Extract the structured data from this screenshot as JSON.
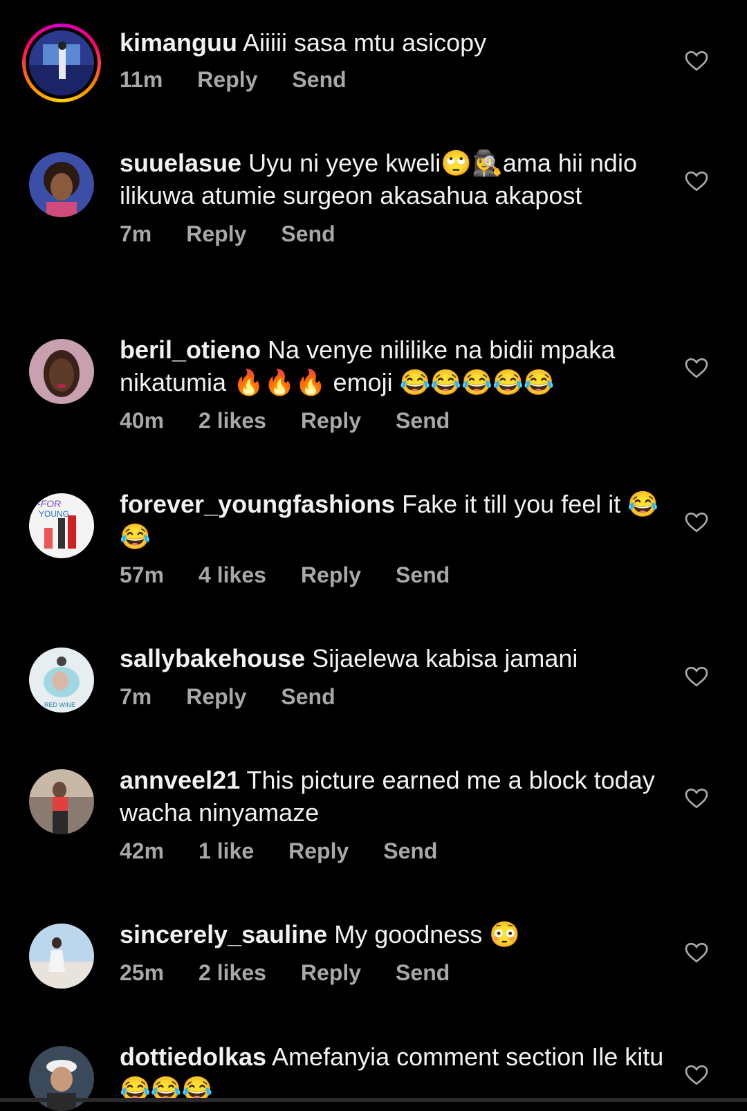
{
  "comments": [
    {
      "username": "kimanguu",
      "text": "Aiiiii sasa mtu asicopy",
      "time": "11m",
      "likes": "",
      "reply": "Reply",
      "send": "Send"
    },
    {
      "username": "suuelasue",
      "text": "Uyu ni yeye kweli🙄🕵️‍♀️ama hii ndio ilikuwa atumie surgeon akasahua akapost",
      "time": "7m",
      "likes": "",
      "reply": "Reply",
      "send": "Send"
    },
    {
      "username": "beril_otieno",
      "text": "Na venye nililike na bidii mpaka nikatumia 🔥🔥🔥 emoji 😂😂😂😂😂",
      "time": "40m",
      "likes": "2 likes",
      "reply": "Reply",
      "send": "Send"
    },
    {
      "username": "forever_youngfashions",
      "text": "Fake it till you feel it 😂😂",
      "time": "57m",
      "likes": "4 likes",
      "reply": "Reply",
      "send": "Send"
    },
    {
      "username": "sallybakehouse",
      "text": "Sijaelewa kabisa jamani",
      "time": "7m",
      "likes": "",
      "reply": "Reply",
      "send": "Send"
    },
    {
      "username": "annveel21",
      "text": "This picture earned me a block today wacha ninyamaze",
      "time": "42m",
      "likes": "1 like",
      "reply": "Reply",
      "send": "Send"
    },
    {
      "username": "sincerely_sauline",
      "text": "My goodness 😳",
      "time": "25m",
      "likes": "2 likes",
      "reply": "Reply",
      "send": "Send"
    },
    {
      "username": "dottiedolkas",
      "text": "Amefanyia comment section Ile kitu😂😂😂",
      "time": "",
      "likes": "",
      "reply": "",
      "send": ""
    }
  ],
  "icons": {
    "like": "heart-outline-icon"
  },
  "colors": {
    "background": "#000000",
    "text": "#f2f2f2",
    "meta": "#a8a8a8"
  }
}
